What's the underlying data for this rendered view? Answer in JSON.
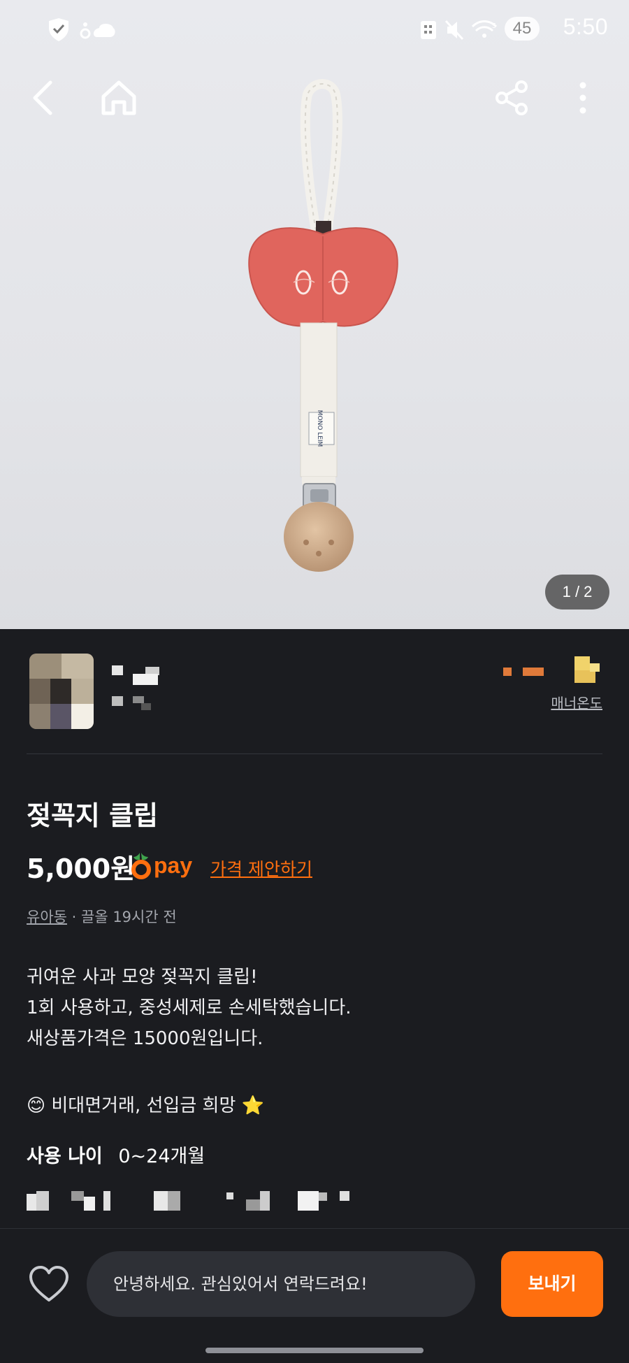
{
  "status_bar": {
    "time": "5:50",
    "battery": "45"
  },
  "image_viewer": {
    "counter": "1 / 2"
  },
  "seller": {
    "manner_label": "매너온도"
  },
  "product": {
    "title": "젖꼭지 클립",
    "price": "5,000원",
    "pay_label": "pay",
    "price_offer": "가격 제안하기",
    "category": "유아동",
    "bump_time": "· 끌올 19시간 전",
    "description": [
      "귀여운 사과 모양 젖꼭지 클립!",
      "1회 사용하고, 중성세제로 손세탁했습니다.",
      "새상품가격은 15000원입니다.",
      "",
      "😊 비대면거래, 선입금 희망 ⭐"
    ],
    "age_label": "사용 나이",
    "age_value": "0~24개월"
  },
  "bottom_bar": {
    "message_text": "안녕하세요. 관심있어서 연락드려요!",
    "send_label": "보내기"
  },
  "colors": {
    "accent": "#ff6f0f",
    "background": "#1b1c20"
  }
}
